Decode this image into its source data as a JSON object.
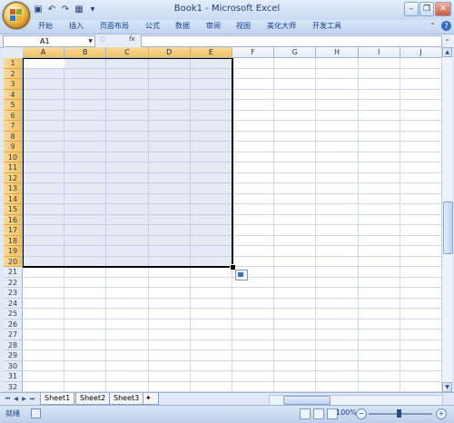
{
  "window": {
    "title": "Book1 - Microsoft Excel",
    "controls": [
      "minimize-icon",
      "restore-icon",
      "close-icon"
    ]
  },
  "quick_access": [
    "save-icon",
    "undo-icon",
    "redo-icon",
    "print-preview-icon",
    "customize-icon"
  ],
  "ribbon": {
    "tabs": [
      "开始",
      "插入",
      "页面布局",
      "公式",
      "数据",
      "审阅",
      "视图",
      "美化大师",
      "开发工具"
    ]
  },
  "formula_bar": {
    "name_box": "A1",
    "fx_label": "fx",
    "formula": ""
  },
  "grid": {
    "columns": [
      "A",
      "B",
      "C",
      "D",
      "E",
      "F",
      "G",
      "H",
      "I",
      "J"
    ],
    "selected_columns": [
      "A",
      "B",
      "C",
      "D",
      "E"
    ],
    "rows": [
      "1",
      "2",
      "3",
      "4",
      "5",
      "6",
      "7",
      "8",
      "9",
      "10",
      "11",
      "12",
      "13",
      "14",
      "15",
      "16",
      "17",
      "18",
      "19",
      "20",
      "21",
      "22",
      "23",
      "24",
      "25",
      "26",
      "27",
      "28",
      "29",
      "30",
      "31",
      "32"
    ],
    "selected_rows_count": 20,
    "selection": "A1:E20",
    "active_cell": "A1"
  },
  "sheets": {
    "tabs": [
      "Sheet1",
      "Sheet2",
      "Sheet3"
    ],
    "active": "Sheet1"
  },
  "status": {
    "ready": "就绪",
    "zoom": "100%"
  },
  "colors": {
    "selection_header": "#f1c15f",
    "grid_line": "#d0d7e5",
    "title_text": "#1f3f6f",
    "ribbon_text": "#15428b"
  }
}
